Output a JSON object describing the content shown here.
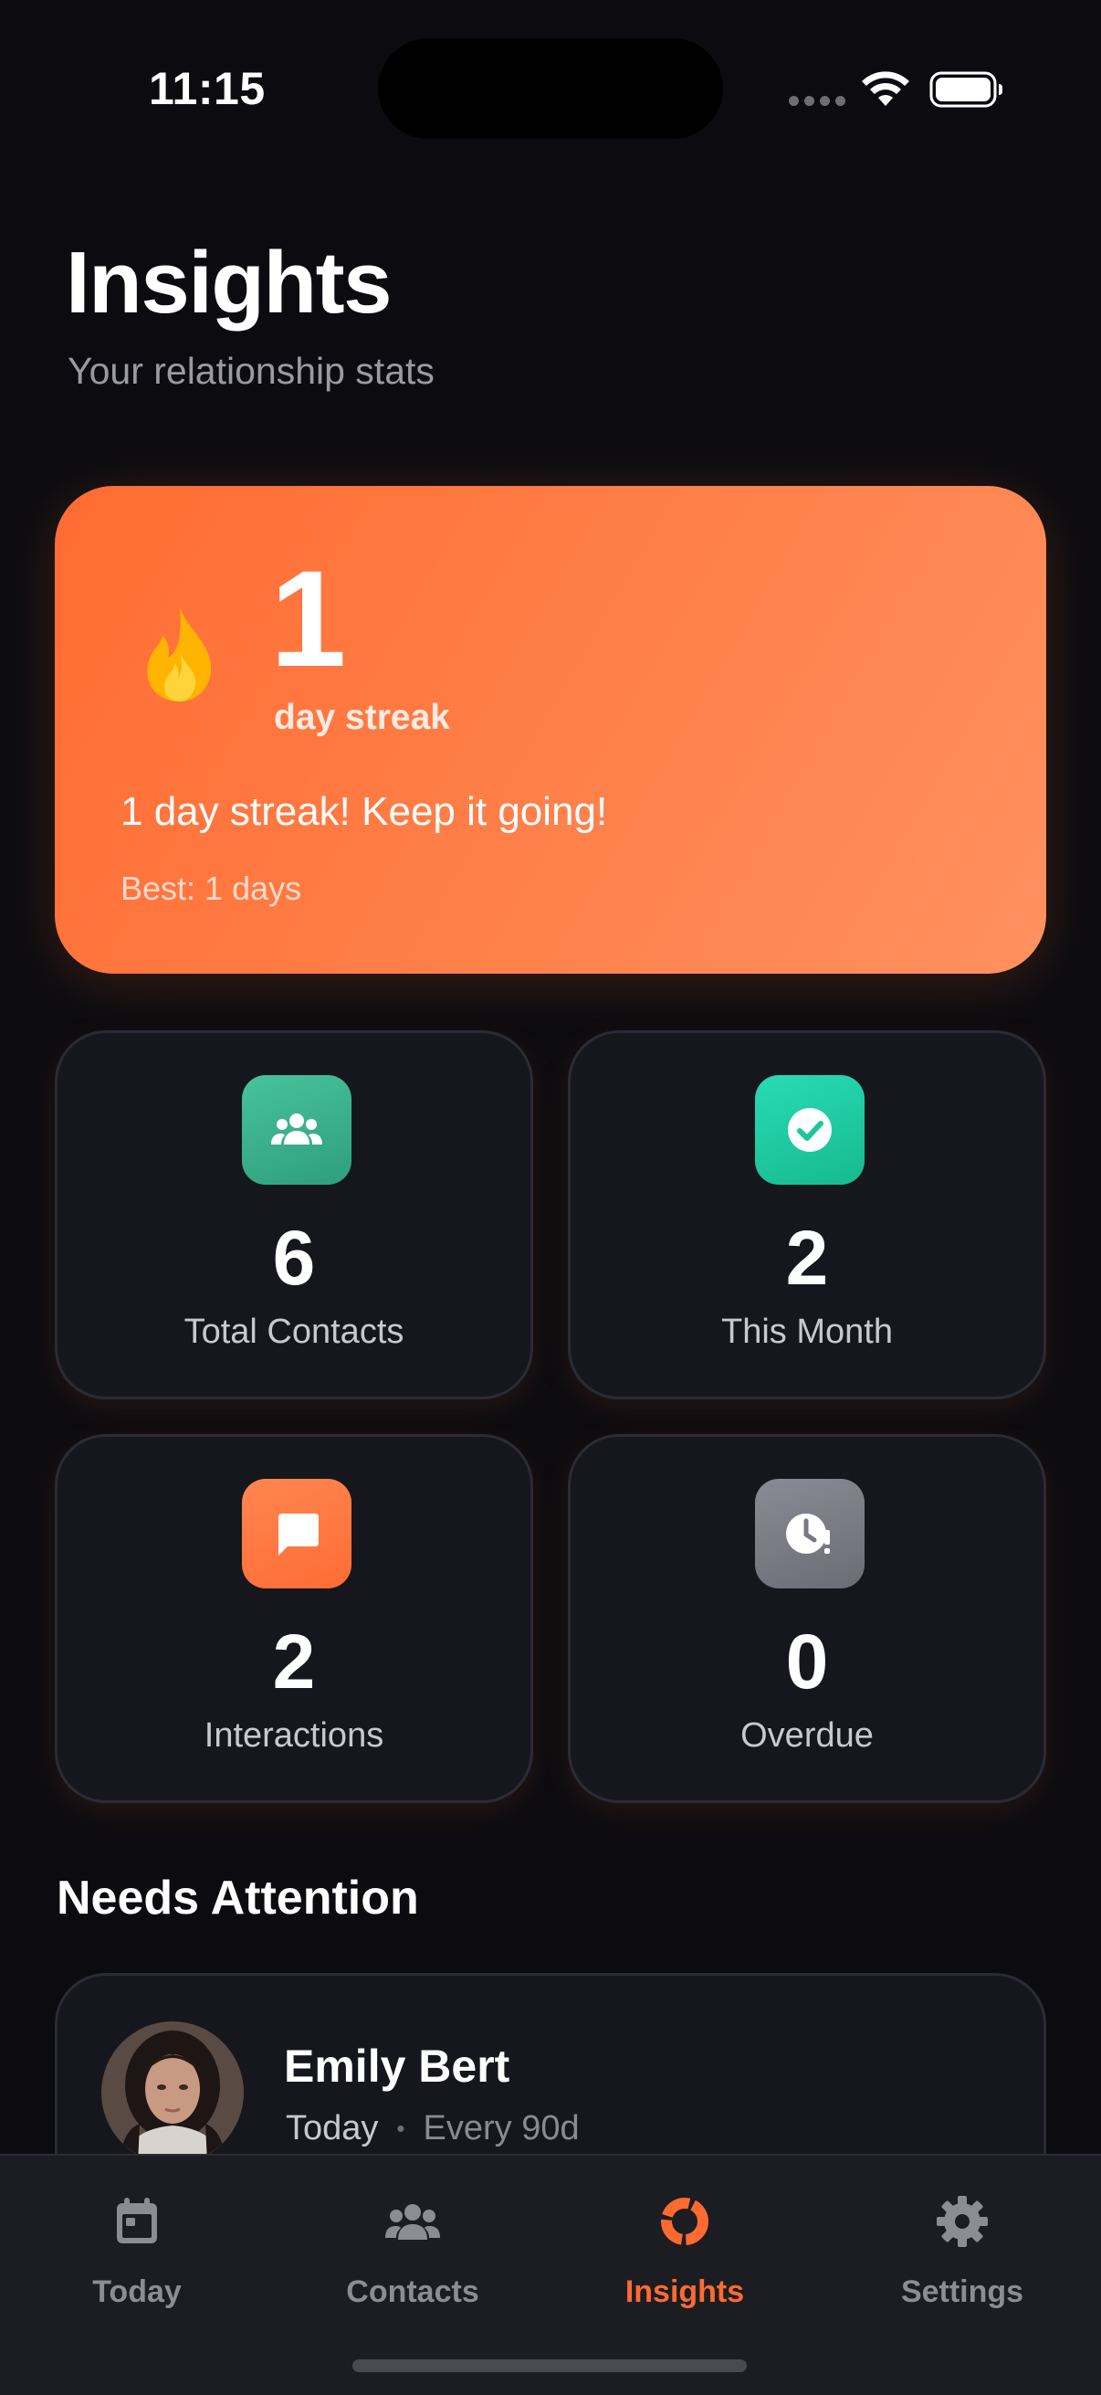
{
  "status_bar": {
    "time": "11:15"
  },
  "header": {
    "title": "Insights",
    "subtitle": "Your relationship stats"
  },
  "streak": {
    "count": "1",
    "unit": "day streak",
    "message": "1 day streak! Keep it going!",
    "best": "Best: 1 days",
    "icon": "flame-icon",
    "gradient": [
      "#ff6c32",
      "#ff9160"
    ]
  },
  "stats": [
    {
      "value": "6",
      "label": "Total Contacts",
      "icon": "people-icon",
      "color": "#3fb98f"
    },
    {
      "value": "2",
      "label": "This Month",
      "icon": "check-circle-icon",
      "color": "#22d3aa"
    },
    {
      "value": "2",
      "label": "Interactions",
      "icon": "chat-bubble-icon",
      "color": "#ff7a45"
    },
    {
      "value": "0",
      "label": "Overdue",
      "icon": "clock-alert-icon",
      "color": "#7c7d86"
    }
  ],
  "needs_attention": {
    "title": "Needs Attention",
    "items": [
      {
        "name": "Emily Bert",
        "due": "Today",
        "frequency": "Every 90d"
      }
    ]
  },
  "tab_bar": {
    "items": [
      {
        "label": "Today",
        "icon": "calendar-icon"
      },
      {
        "label": "Contacts",
        "icon": "people-icon"
      },
      {
        "label": "Insights",
        "icon": "donut-chart-icon",
        "active": true
      },
      {
        "label": "Settings",
        "icon": "gear-icon"
      }
    ],
    "active_color": "#ff6a30",
    "inactive_color": "#8b8c94"
  }
}
